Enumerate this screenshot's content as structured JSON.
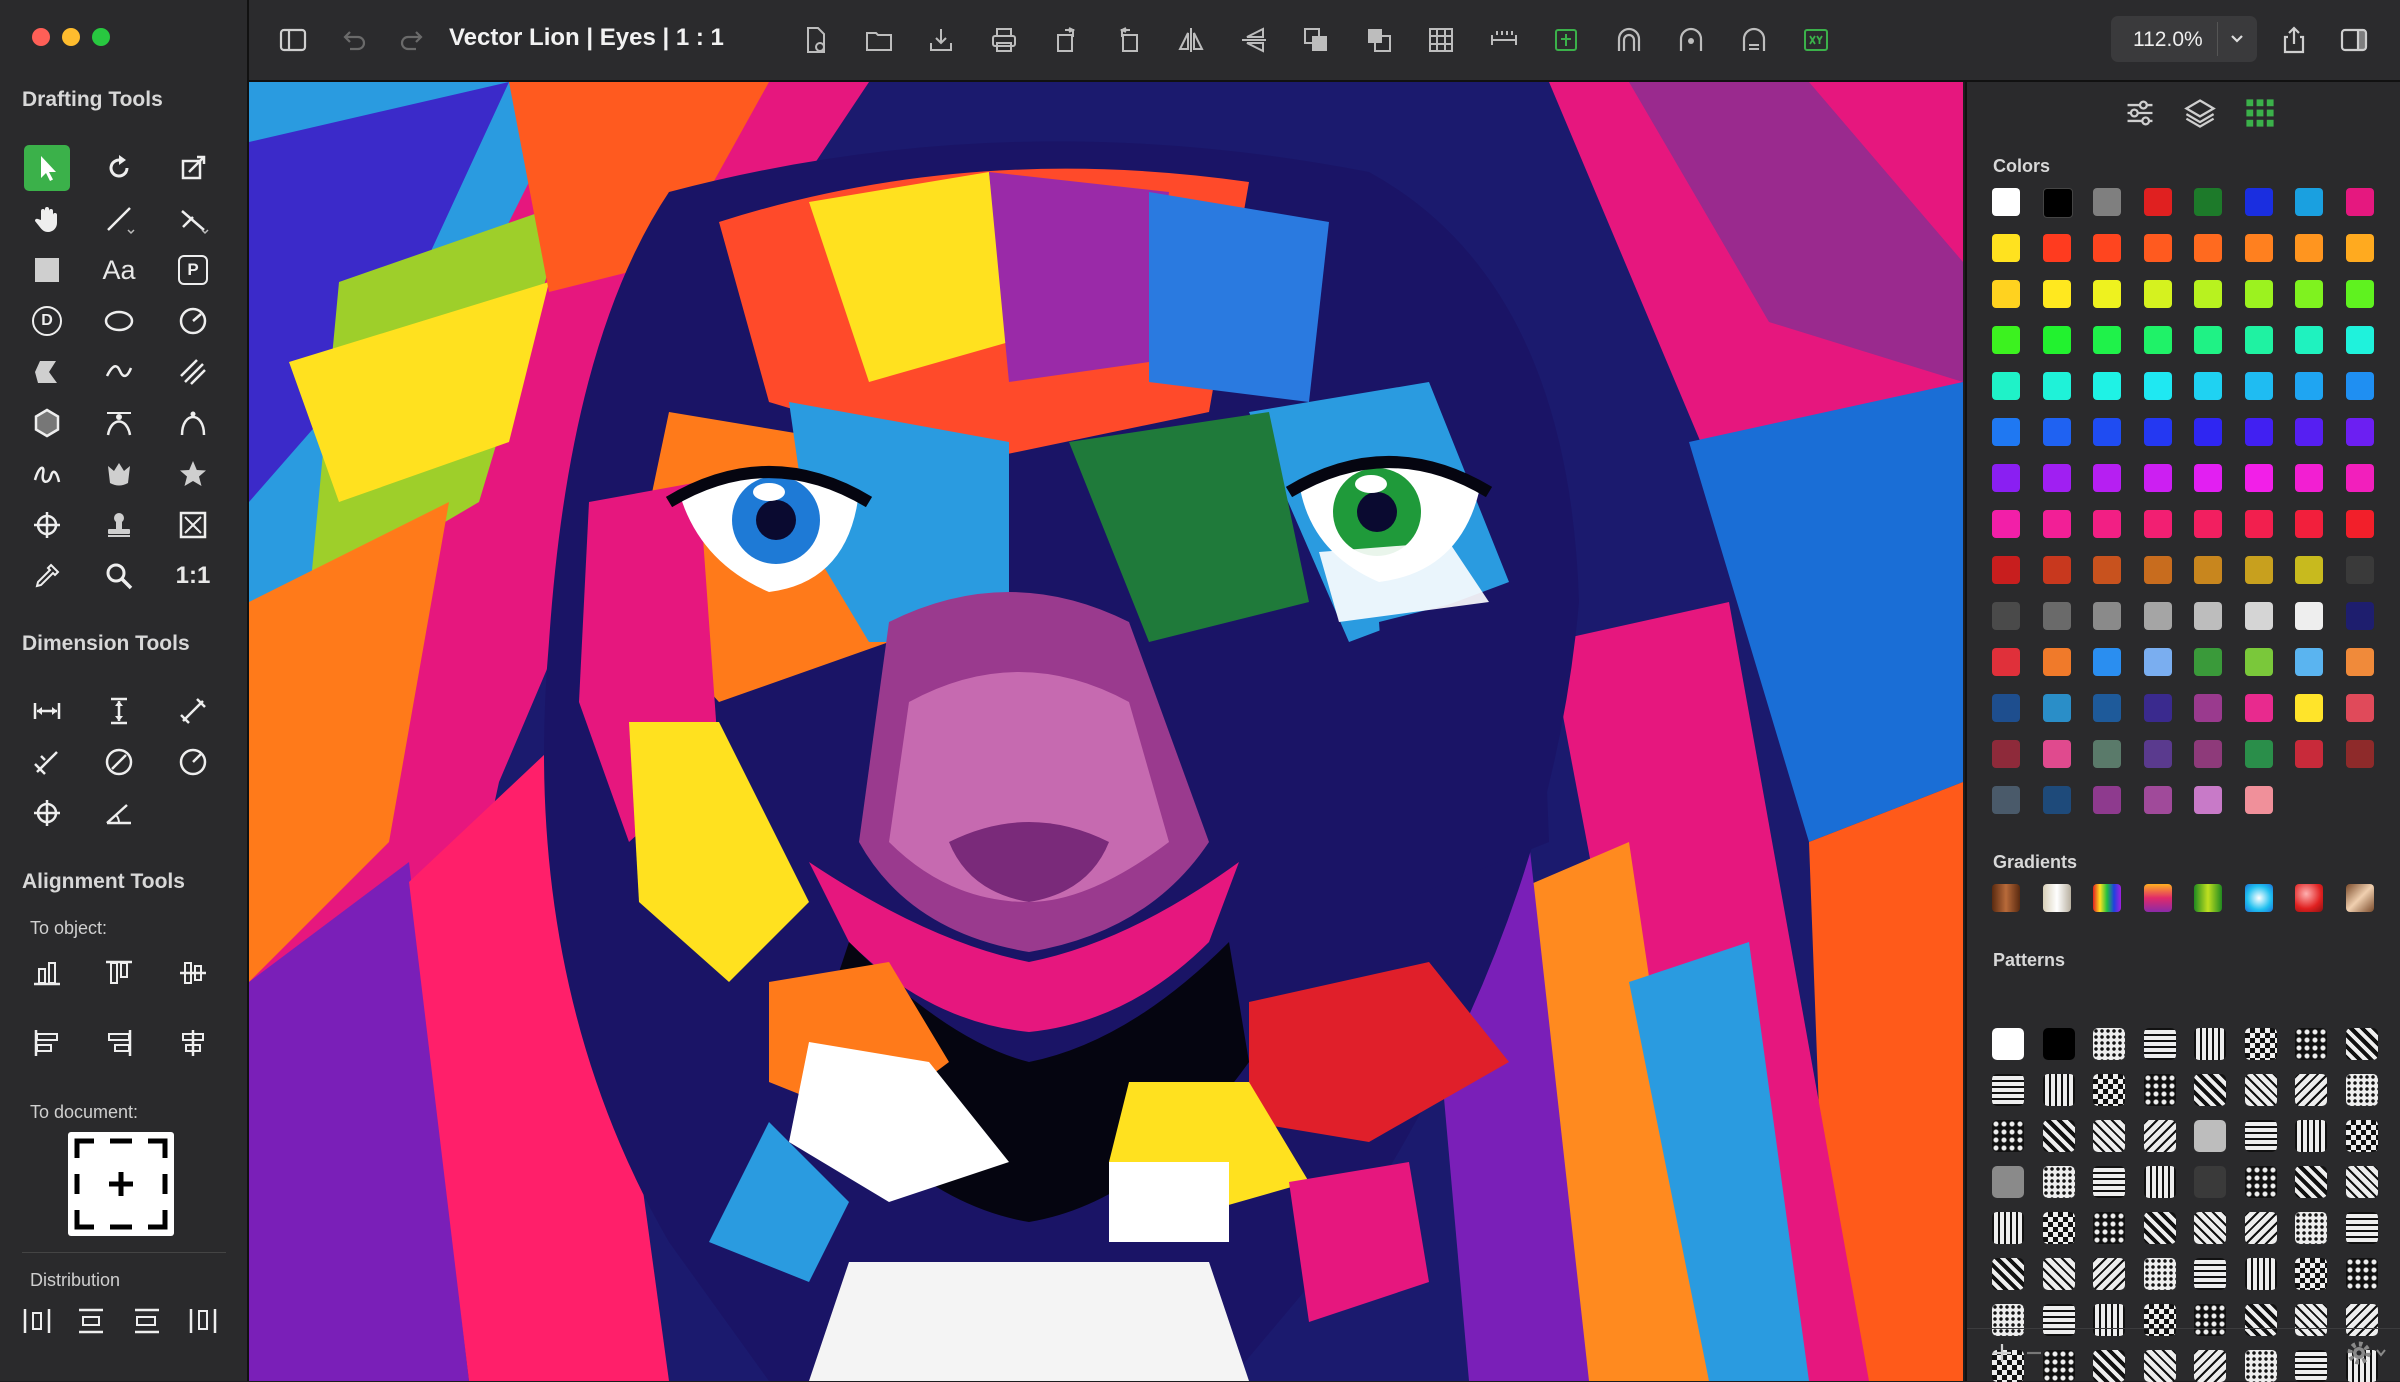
{
  "window": {
    "title": "Vector Lion | Eyes | 1 : 1",
    "zoom": "112.0%"
  },
  "sidebar": {
    "drafting_title": "Drafting Tools",
    "dimension_title": "Dimension Tools",
    "alignment_title": "Alignment Tools",
    "to_object": "To object:",
    "to_document": "To document:",
    "distribution": "Distribution",
    "text_tool_label": "Aa",
    "one_to_one_label": "1:1",
    "p_tool_label": "P",
    "d_tool_label": "D"
  },
  "panel": {
    "colors_title": "Colors",
    "gradients_title": "Gradients",
    "patterns_title": "Patterns",
    "colors": [
      [
        "#ffffff",
        "#000000",
        "#7f7f7f",
        "#e02020",
        "#1d7a2a",
        "#1a2ee0",
        "#1aa0e0",
        "#e5187f"
      ],
      [
        "#ffe21f",
        "#ff3b1f",
        "#ff451f",
        "#ff5a1f",
        "#ff6a1f",
        "#ff801f",
        "#ff951f",
        "#ffaa1f"
      ],
      [
        "#ffd21f",
        "#ffe81f",
        "#eef21f",
        "#d5f21f",
        "#b8f21f",
        "#9cf21f",
        "#7ff21f",
        "#5ff21f"
      ],
      [
        "#3cf21f",
        "#22f22f",
        "#1ff24a",
        "#1ff268",
        "#1ff285",
        "#1ff2a2",
        "#1ff2bf",
        "#1ff2dc"
      ],
      [
        "#1ff2c8",
        "#1ff2d8",
        "#1ff2e5",
        "#1fe8f2",
        "#1fd2f2",
        "#1fbcf2",
        "#1fa5f2",
        "#1f8ff2"
      ],
      [
        "#1f78f2",
        "#1f62f2",
        "#1f4cf2",
        "#2438f2",
        "#2f26f2",
        "#4120f2",
        "#561ff2",
        "#6c1ff2"
      ],
      [
        "#8a1ff2",
        "#a01ff2",
        "#b61ff2",
        "#cc1ff2",
        "#e21ff2",
        "#f21fe8",
        "#f21fd2",
        "#f21fbc"
      ],
      [
        "#f21fa8",
        "#f21f96",
        "#f21f84",
        "#f21f72",
        "#f21f60",
        "#f21f4e",
        "#f21f3c",
        "#f21f2a"
      ],
      [
        "#c81e1e",
        "#c8381e",
        "#c8521e",
        "#c86c1e",
        "#c8861e",
        "#c8a01e",
        "#c8ba1e",
        "#3a3a3a"
      ],
      [
        "#4a4a4a",
        "#6a6a6a",
        "#8a8a8a",
        "#a5a5a5",
        "#bdbdbd",
        "#d5d5d5",
        "#eeeeee",
        "#1e1e6e"
      ],
      [
        "#e0303a",
        "#f07a2a",
        "#2a8ef0",
        "#7aaef0",
        "#3a9a3a",
        "#7ac83a",
        "#5ab4f0",
        "#f08a3a"
      ],
      [
        "#1e4e8e",
        "#2a8ec8",
        "#1e5a9a",
        "#3a2a8e",
        "#9a3a8e",
        "#e82a8e",
        "#ffe42a",
        "#e04a5a"
      ],
      [
        "#8e2a3a",
        "#e04a8e",
        "#5a7a6a",
        "#5a3a8e",
        "#8e3a7a",
        "#2a8e4a",
        "#c82a3a",
        "#8e2a2a"
      ],
      [
        "#4a5a6a",
        "#1e4a7a",
        "#8e3a8e",
        "#a04a9a",
        "#c87ac8",
        "#f0909a"
      ]
    ],
    "gradient_names": [
      "wood-gradient",
      "pearl-gradient",
      "rainbow-gradient",
      "sunset-gradient",
      "lime-gradient",
      "aqua-gradient",
      "ruby-gradient",
      "bronze-gradient"
    ]
  }
}
